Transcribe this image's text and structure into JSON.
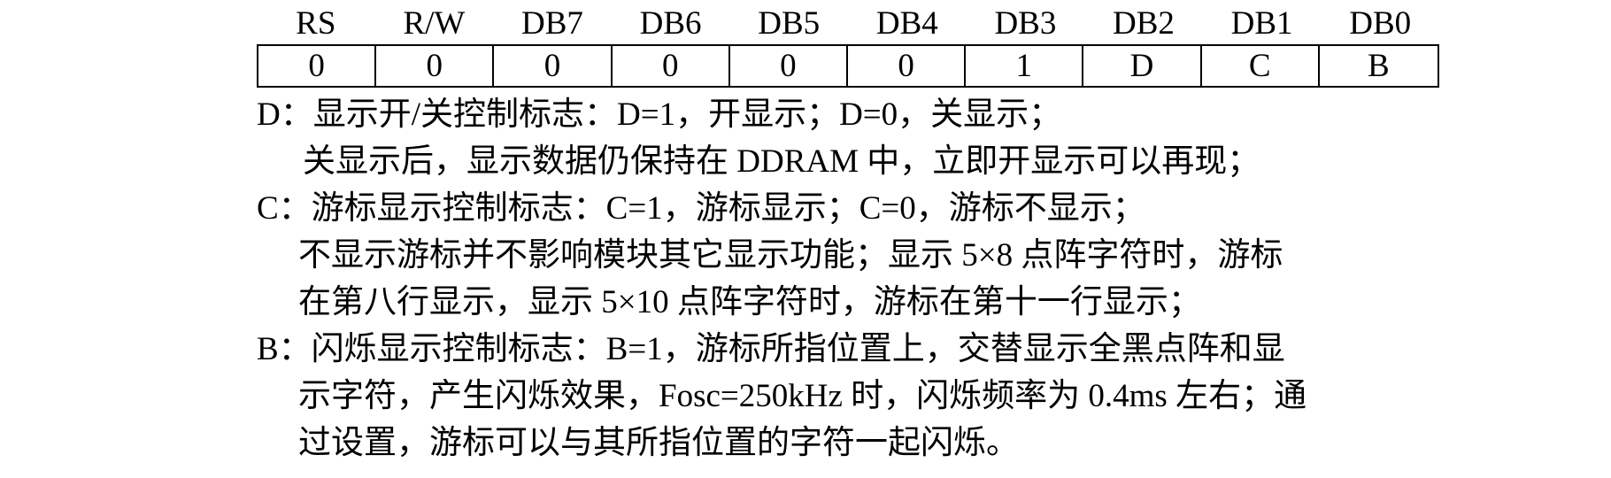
{
  "register": {
    "headers": [
      "RS",
      "R/W",
      "DB7",
      "DB6",
      "DB5",
      "DB4",
      "DB3",
      "DB2",
      "DB1",
      "DB0"
    ],
    "values": [
      "0",
      "0",
      "0",
      "0",
      "0",
      "0",
      "1",
      "D",
      "C",
      "B"
    ]
  },
  "description": {
    "d_line1": "D：显示开/关控制标志：D=1，开显示；D=0，关显示；",
    "d_line2": "关显示后，显示数据仍保持在 DDRAM 中，立即开显示可以再现；",
    "c_line1": "C：游标显示控制标志：C=1，游标显示；C=0，游标不显示；",
    "c_line2": "不显示游标并不影响模块其它显示功能；显示 5×8 点阵字符时，游标",
    "c_line3": "在第八行显示，显示 5×10 点阵字符时，游标在第十一行显示；",
    "b_line1": "B：闪烁显示控制标志：B=1，游标所指位置上，交替显示全黑点阵和显",
    "b_line2": "示字符，产生闪烁效果，Fosc=250kHz 时，闪烁频率为 0.4ms 左右；通",
    "b_line3": "过设置，游标可以与其所指位置的字符一起闪烁。"
  }
}
